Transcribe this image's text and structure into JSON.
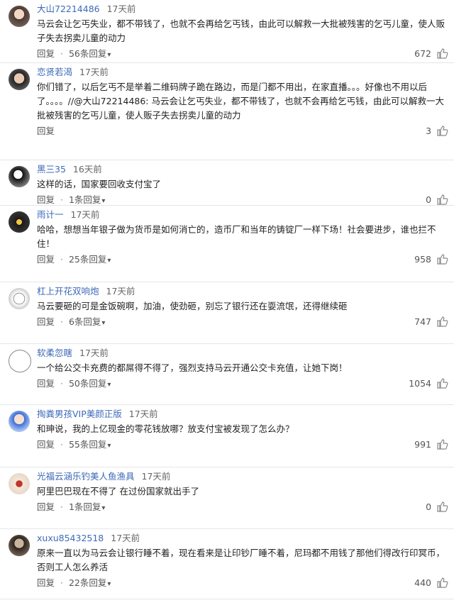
{
  "ui": {
    "reply_label": "回复",
    "separator": "·"
  },
  "comments": [
    {
      "user": "大山72214486",
      "time": "17天前",
      "text": "马云会让乞丐失业，都不带钱了，也就不会再给乞丐钱，由此可以解救一大批被残害的乞丐儿童，使人贩子失去拐卖儿童的动力",
      "replies": "56条回复",
      "likes": "672"
    },
    {
      "user": "恋贤若渴",
      "time": "17天前",
      "text": "你们错了，以后乞丐不是举着二维码牌子跪在路边，而是门都不用出，在家直播。。。好像也不用以后了。。。。//@大山72214486: 马云会让乞丐失业，都不带钱了，也就不会再给乞丐钱，由此可以解救一大批被残害的乞丐儿童，使人贩子失去拐卖儿童的动力",
      "replies": "",
      "likes": "3"
    },
    {
      "user": "黑三35",
      "time": "16天前",
      "text": "这样的话，国家要回收支付宝了",
      "replies": "1条回复",
      "likes": "0"
    },
    {
      "user": "雨计一",
      "time": "17天前",
      "text": "哈哈，想想当年银子做为货币是如何消亡的，造币厂和当年的铸锭厂一样下场！社会要进步，谁也拦不住！",
      "replies": "25条回复",
      "likes": "958"
    },
    {
      "user": "杠上开花双响炮",
      "time": "17天前",
      "text": "马云要砸的可是金饭碗啊，加油，使劲砸，别忘了银行还在耍流氓，还得继续砸",
      "replies": "6条回复",
      "likes": "747"
    },
    {
      "user": "软柔忽瞎",
      "time": "17天前",
      "text": "一个给公交卡充费的都屌得不得了，强烈支持马云开通公交卡充值，让她下岗！",
      "replies": "50条回复",
      "likes": "1054"
    },
    {
      "user": "掏粪男孩VIP美颜正版",
      "time": "17天前",
      "text": "和珅说，我的上亿现金的零花钱放哪？放支付宝被发现了怎么办？",
      "replies": "55条回复",
      "likes": "991"
    },
    {
      "user": "光福云涵乐钓美人鱼渔具",
      "time": "17天前",
      "text": "阿里巴巴现在不得了 在过份国家就出手了",
      "replies": "1条回复",
      "likes": "0"
    },
    {
      "user": "xuxu85432518",
      "time": "17天前",
      "text": "原来一直以为马云会让银行睡不着，现在看来是让印钞厂睡不着，尼玛都不用钱了那他们得改行印冥币，否则工人怎么养活",
      "replies": "22条回复",
      "likes": "440"
    }
  ]
}
